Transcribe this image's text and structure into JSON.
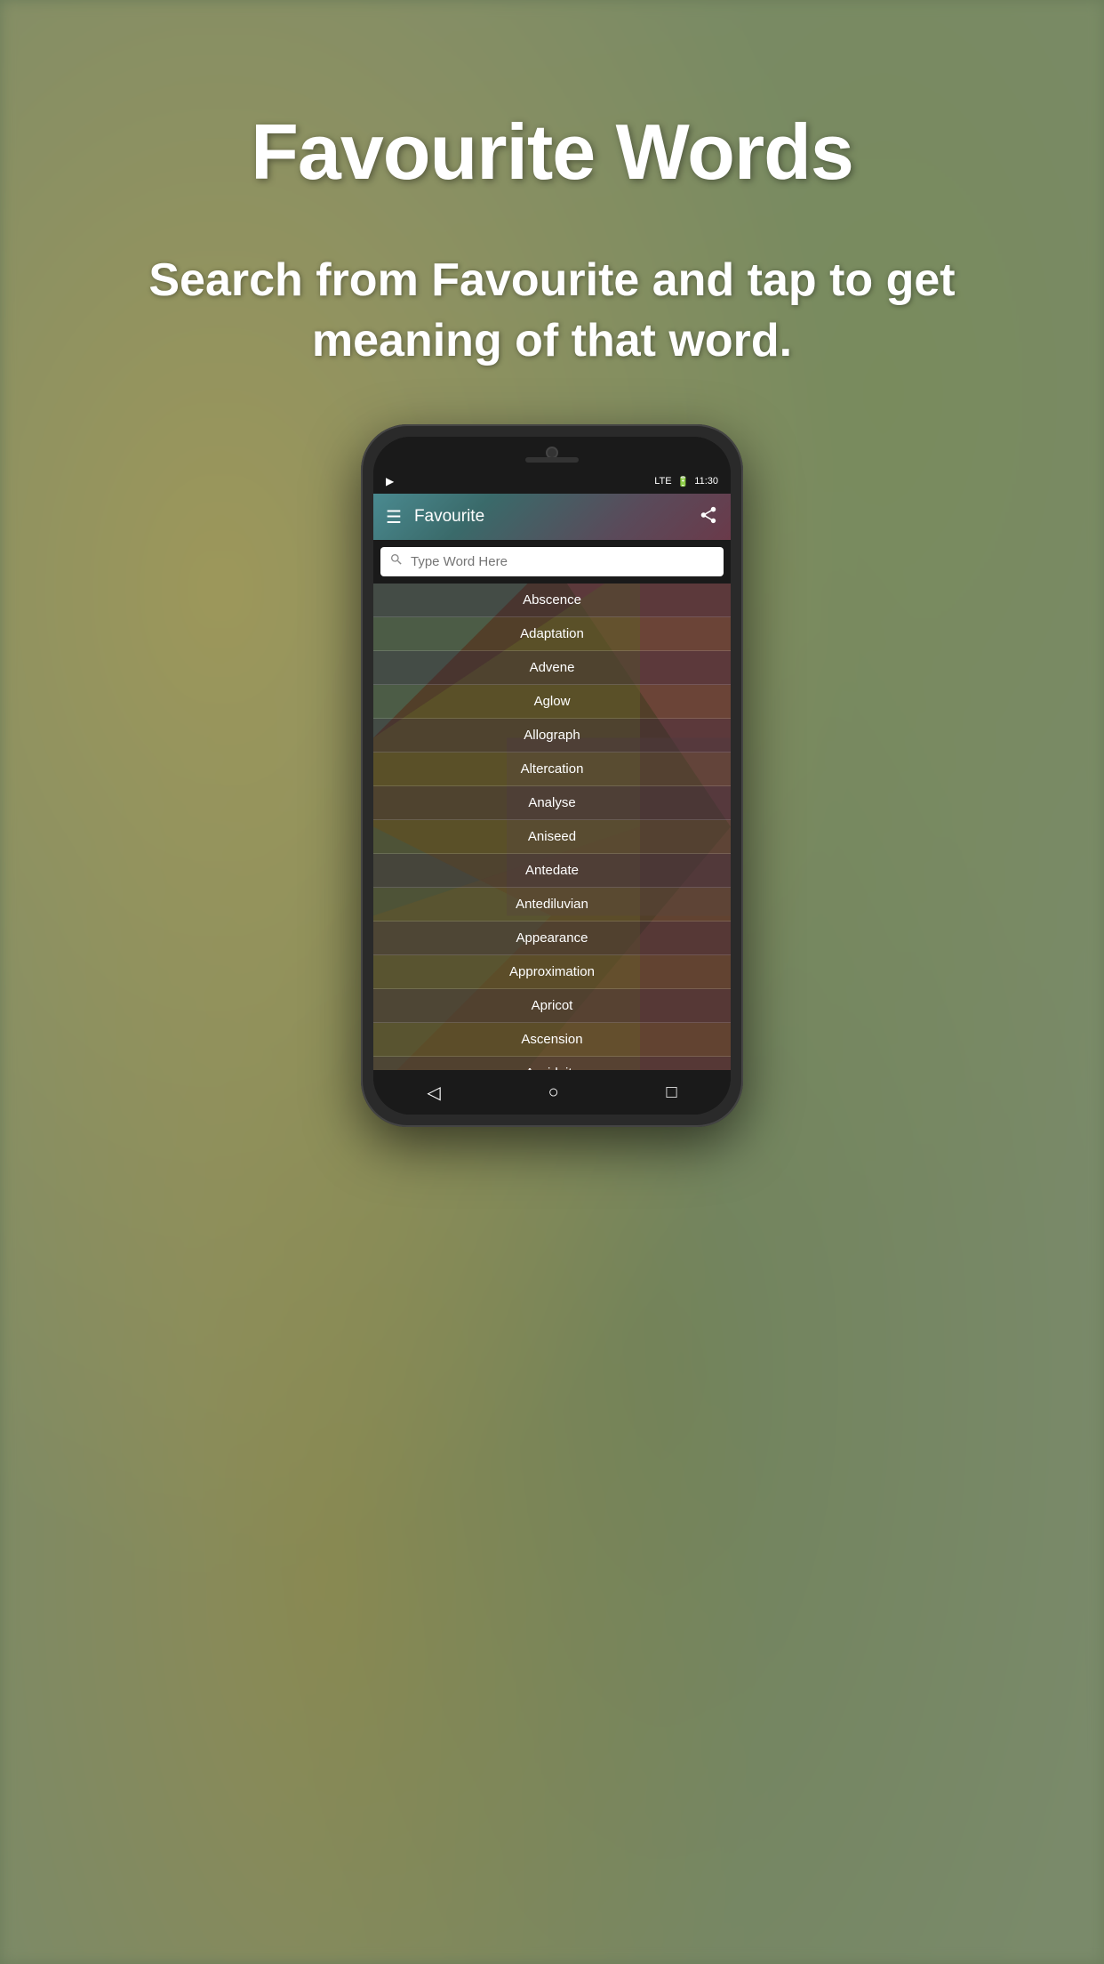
{
  "page": {
    "title": "Favourite Words",
    "subtitle": "Search from Favourite and tap to get meaning of that word.",
    "bg_color": "#7a8a6a"
  },
  "phone": {
    "status_bar": {
      "left_icon": "▶",
      "signal": "LTE",
      "battery": "🔋",
      "time": "11:30"
    },
    "toolbar": {
      "title": "Favourite",
      "menu_icon": "☰",
      "share_icon": "share"
    },
    "search": {
      "placeholder": "Type Word Here"
    },
    "words": [
      "Abscence",
      "Adaptation",
      "Advene",
      "Aglow",
      "Allograph",
      "Altercation",
      "Analyse",
      "Aniseed",
      "Antedate",
      "Antediluvian",
      "Appearance",
      "Approximation",
      "Apricot",
      "Ascension",
      "Assiduity"
    ],
    "nav": {
      "back": "◁",
      "home": "○",
      "recents": "□"
    }
  }
}
